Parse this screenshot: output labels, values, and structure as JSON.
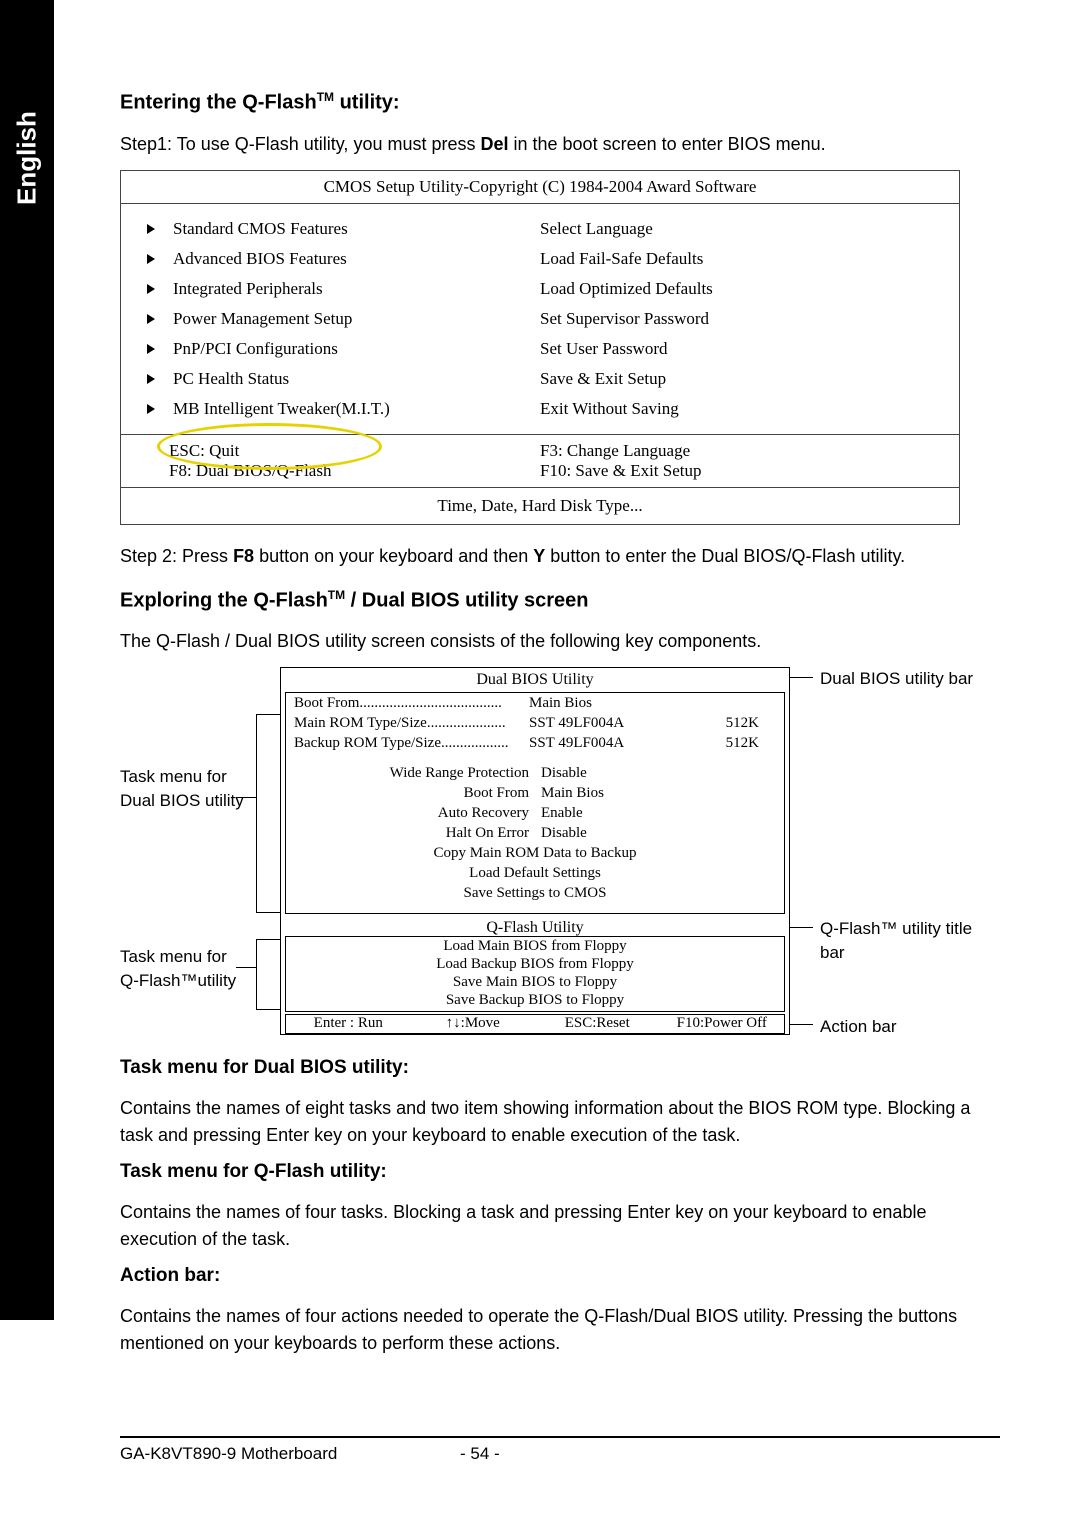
{
  "language_tab": "English",
  "section1": {
    "title_pre": "Entering the Q-Flash",
    "title_post": " utility:",
    "step1_pre": "Step1: To use Q-Flash utility, you must press ",
    "step1_bold": "Del",
    "step1_post": " in the boot screen to enter BIOS menu."
  },
  "cmos": {
    "title": "CMOS Setup Utility-Copyright (C) 1984-2004 Award Software",
    "left": [
      "Standard CMOS Features",
      "Advanced BIOS Features",
      "Integrated Peripherals",
      "Power Management Setup",
      "PnP/PCI Configurations",
      "PC Health Status",
      "MB Intelligent Tweaker(M.I.T.)"
    ],
    "right": [
      "Select Language",
      "Load Fail-Safe Defaults",
      "Load Optimized Defaults",
      "Set Supervisor Password",
      "Set User Password",
      "Save & Exit Setup",
      "Exit Without Saving"
    ],
    "foot_left1": "ESC: Quit",
    "foot_right1": "F3: Change Language",
    "foot_left2": "F8: Dual BIOS/Q-Flash",
    "foot_right2": "F10: Save & Exit Setup",
    "foot_bottom": "Time, Date, Hard Disk Type..."
  },
  "step2_pre": "Step 2: Press ",
  "step2_b1": "F8",
  "step2_mid": " button on your keyboard and then ",
  "step2_b2": "Y",
  "step2_post": " button to enter the Dual BIOS/Q-Flash utility.",
  "section2": {
    "title_pre": "Exploring the Q-Flash",
    "title_post": " / Dual BIOS utility screen",
    "desc": "The Q-Flash / Dual BIOS utility screen consists of the following key components."
  },
  "dual": {
    "title": "Dual BIOS Utility",
    "boot_from_label": "Boot From......................................",
    "boot_from_value": "Main Bios",
    "main_rom_label": "Main ROM Type/Size.....................",
    "main_rom_value1": "SST 49LF004A",
    "main_rom_value2": "512K",
    "backup_rom_label": "Backup ROM Type/Size..................",
    "backup_rom_value1": "SST 49LF004A",
    "backup_rom_value2": "512K",
    "settings": [
      {
        "k": "Wide Range Protection",
        "v": "Disable"
      },
      {
        "k": "Boot From",
        "v": "Main Bios"
      },
      {
        "k": "Auto Recovery",
        "v": "Enable"
      },
      {
        "k": "Halt On Error",
        "v": "Disable"
      }
    ],
    "tasks1": [
      "Copy Main ROM Data to Backup",
      "Load Default Settings",
      "Save Settings to CMOS"
    ],
    "qflash_title": "Q-Flash Utility",
    "tasks2": [
      "Load Main BIOS from Floppy",
      "Load Backup BIOS from Floppy",
      "Save Main BIOS to Floppy",
      "Save Backup BIOS to Floppy"
    ],
    "action": [
      "Enter : Run",
      "↑↓:Move",
      "ESC:Reset",
      "F10:Power Off"
    ]
  },
  "labels": {
    "task_dual": "Task menu for Dual BIOS utility",
    "task_qflash_l1": "Task menu for",
    "task_qflash_l2": "Q-Flash™utility",
    "dual_bar": "Dual BIOS utility bar",
    "qflash_bar_l1": "Q-Flash™ utility title",
    "qflash_bar_l2": "bar",
    "action_bar": "Action bar"
  },
  "body": {
    "h_task_dual": "Task menu for Dual BIOS utility:",
    "p_task_dual": "Contains the names of eight tasks and two item showing information about the BIOS ROM type. Blocking a task and pressing Enter key on your keyboard to enable execution of the task.",
    "h_task_qflash": "Task menu for Q-Flash utility:",
    "p_task_qflash": "Contains the names of four tasks. Blocking a task and pressing Enter key on your keyboard to enable execution of the task.",
    "h_action": "Action bar:",
    "p_action": "Contains the names of four actions needed to operate the Q-Flash/Dual BIOS utility. Pressing the buttons mentioned on your keyboards to perform these actions."
  },
  "footer": {
    "left": "GA-K8VT890-9 Motherboard",
    "page": "- 54 -"
  }
}
